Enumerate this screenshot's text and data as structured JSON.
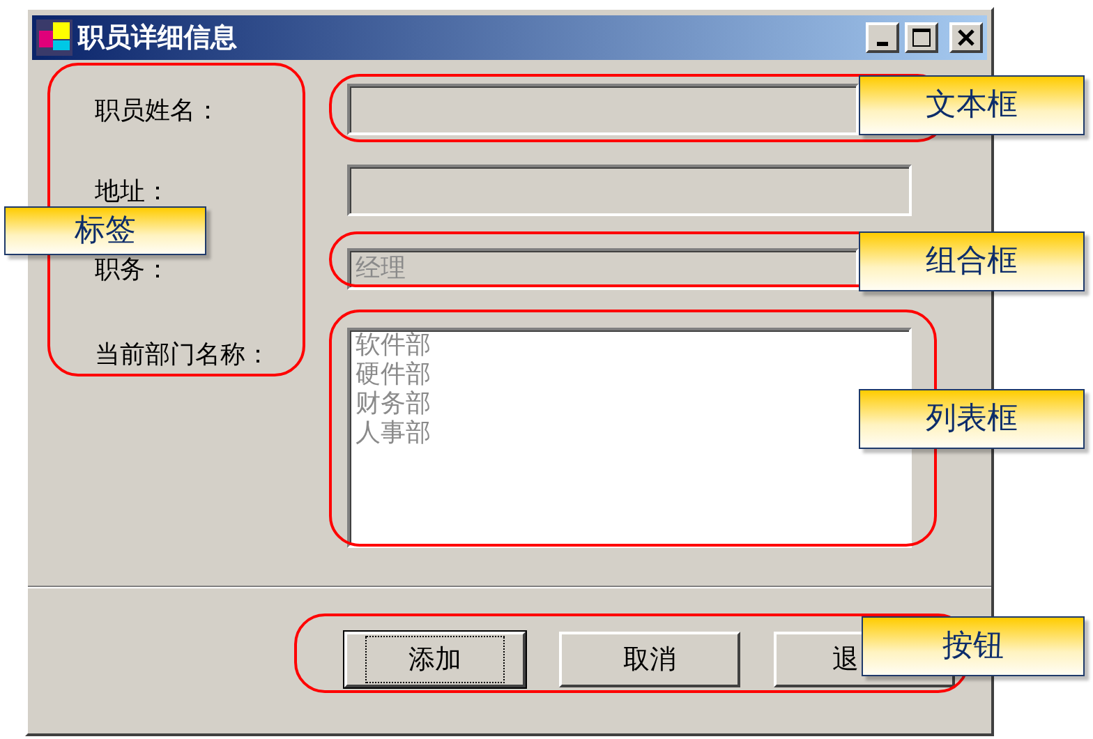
{
  "window": {
    "title": "职员详细信息"
  },
  "fields": [
    {
      "kind": "textbox",
      "label": "职员姓名：",
      "disabled": true
    },
    {
      "kind": "textbox",
      "label": "地址：",
      "disabled": true
    },
    {
      "kind": "combobox",
      "label": "职务：",
      "value": "经理",
      "disabled": true
    },
    {
      "kind": "listbox",
      "label": "当前部门名称：",
      "items": [
        "软件部",
        "硬件部",
        "财务部",
        "人事部"
      ],
      "disabled": true
    }
  ],
  "buttons": [
    {
      "label": "添加",
      "default": true
    },
    {
      "label": "取消",
      "default": false
    },
    {
      "label": "退",
      "default": false
    }
  ],
  "callouts": [
    {
      "kind": "labels",
      "text": "标签"
    },
    {
      "kind": "textbox",
      "text": "文本框"
    },
    {
      "kind": "combobox",
      "text": "组合框"
    },
    {
      "kind": "listbox",
      "text": "列表框"
    },
    {
      "kind": "buttons",
      "text": "按钮"
    }
  ]
}
